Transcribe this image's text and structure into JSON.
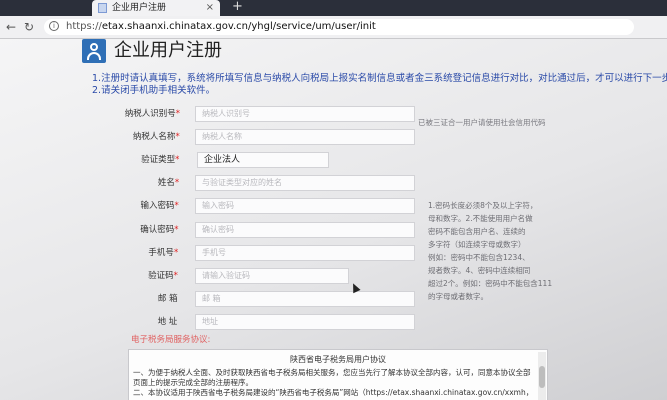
{
  "browser": {
    "tab_title": "企业用户注册",
    "tab_close": "×",
    "new_tab": "+",
    "url": "https://etax.shaanxi.chinatax.gov.cn/yhgl/service/um/user/init",
    "url_scheme": "https://",
    "url_rest": "etax.shaanxi.chinatax.gov.cn/yhgl/service/um/user/init",
    "back": "←",
    "reload": "↻"
  },
  "page": {
    "title": "企业用户注册",
    "notices": [
      "1.注册时请认真填写，系统将所填写信息与纳税人向税局上报实名制信息或者金三系统登记信息进行对比，对比通过后，才可以进行下一步操作。",
      "2.请关闭手机助手相关软件。"
    ]
  },
  "form": {
    "fields": [
      {
        "label": "纳税人识别号",
        "required": true,
        "placeholder": "纳税人识别号",
        "value": ""
      },
      {
        "label": "纳税人名称",
        "required": true,
        "placeholder": "纳税人名称",
        "value": ""
      },
      {
        "label": "验证类型",
        "required": true,
        "placeholder": "",
        "value": "企业法人"
      },
      {
        "label": "姓名",
        "required": true,
        "placeholder": "与验证类型对应的姓名",
        "value": ""
      },
      {
        "label": "输入密码",
        "required": true,
        "placeholder": "输入密码",
        "value": ""
      },
      {
        "label": "确认密码",
        "required": true,
        "placeholder": "确认密码",
        "value": ""
      },
      {
        "label": "手机号",
        "required": true,
        "placeholder": "手机号",
        "value": ""
      },
      {
        "label": "验证码",
        "required": true,
        "placeholder": "请输入验证码",
        "value": ""
      },
      {
        "label": "邮 箱",
        "required": false,
        "placeholder": "邮 箱",
        "value": ""
      },
      {
        "label": "地 址",
        "required": false,
        "placeholder": "地址",
        "value": ""
      }
    ],
    "required_mark": "*",
    "side_hint": "已被三证合一用户请使用社会信用代码",
    "password_rules": [
      "1.密码长度必须8个及以上字符，",
      "母和数字。2.不能使用用户名做",
      "密码不能包含用户名、连续的",
      "多字符（如连续字母或数字）",
      "例如：密码中不能包含1234、",
      "规者数字。4、密码中连续相同",
      "超过2个。例如：密码中不能包含111",
      "的字母或者数字。"
    ]
  },
  "agreement": {
    "section_title": "电子税务局服务协议:",
    "doc_title": "陕西省电子税务局用户协议",
    "paragraphs": [
      "一、为便于纳税人全面、及时获取陕西省电子税务局相关服务，您应当先行了解本协议全部内容，认可，同意本协议全部条款并按照",
      "页面上的提示完成全部的注册程序。",
      "二、本协议适用于陕西省电子税务局建设的“陕西省电子税务局”网站（https://etax.shaanxi.chinatax.gov.cn/xxmh，以下简称“本"
    ]
  }
}
